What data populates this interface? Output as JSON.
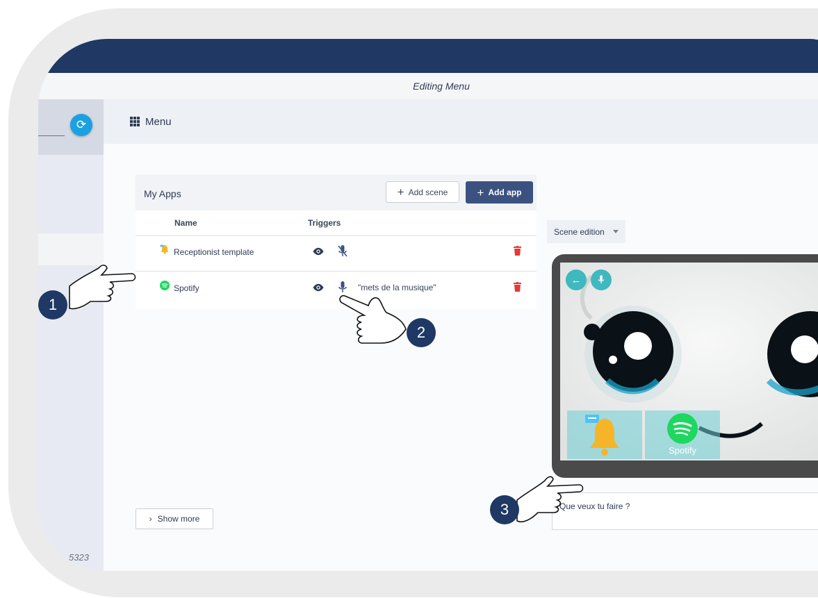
{
  "window": {
    "title": "Editing Menu"
  },
  "sidebar": {
    "sync_icon": "sync-icon",
    "version": "5323"
  },
  "header": {
    "icon": "grid-icon",
    "title": "Menu"
  },
  "apps_card": {
    "title": "My Apps",
    "add_scene_label": "Add scene",
    "add_app_label": "Add app",
    "columns": [
      "Name",
      "Triggers"
    ],
    "rows": [
      {
        "name": "Receptionist template",
        "icon": "bell-icon",
        "visible_icon": "eye-icon",
        "voice_icon": "mic-off-icon",
        "trigger": "",
        "delete_icon": "trash-icon"
      },
      {
        "name": "Spotify",
        "icon": "spotify-icon",
        "visible_icon": "eye-icon",
        "voice_icon": "mic-icon",
        "trigger": "\"mets de la musique\"",
        "delete_icon": "trash-icon"
      }
    ],
    "show_more_label": "Show more"
  },
  "scene": {
    "select_value": "Scene edition",
    "tiles": [
      {
        "label": "",
        "icon": "bell-icon"
      },
      {
        "label": "Spotify",
        "icon": "spotify-icon"
      }
    ],
    "prompt": "Que veux tu faire ?"
  },
  "annotations": [
    "1",
    "2",
    "3"
  ],
  "colors": {
    "topbar": "#1f3864",
    "accent": "#3b5280",
    "delete": "#e53935",
    "screen_buttons": "#3fb8bf"
  }
}
